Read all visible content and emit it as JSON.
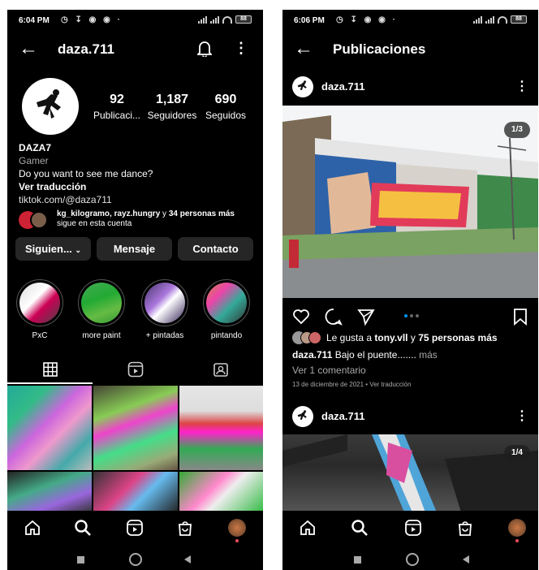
{
  "colors": {
    "background": "#000000",
    "accent": "#0095f6",
    "notify": "#ed4956"
  },
  "left": {
    "status": {
      "time": "6:04 PM",
      "battery": "88"
    },
    "header": {
      "title": "daza.711"
    },
    "stats": [
      {
        "value": "92",
        "label": "Publicaci..."
      },
      {
        "value": "1,187",
        "label": "Seguidores"
      },
      {
        "value": "690",
        "label": "Seguidos"
      }
    ],
    "bio": {
      "name": "DAZA7",
      "category": "Gamer",
      "text": "Do you want to see me dance?",
      "translate": "Ver traducción",
      "link": "tiktok.com/@daza711"
    },
    "followed_by": {
      "names": "kg_kilogramo, rayz.hungry",
      "mid": " y ",
      "others": "34 personas más",
      "suffix": "sigue en esta cuenta"
    },
    "buttons": {
      "following": "Siguien...",
      "message": "Mensaje",
      "contact": "Contacto"
    },
    "highlights": [
      "PxC",
      "more paint",
      "+ pintadas",
      "pintando"
    ],
    "tabs": [
      "grid",
      "reels",
      "tagged"
    ]
  },
  "right": {
    "status": {
      "time": "6:06 PM",
      "battery": "88"
    },
    "header": {
      "title": "Publicaciones"
    },
    "post1": {
      "user": "daza.711",
      "counter": "1/3",
      "likes_prefix": "Le gusta a ",
      "likes_user": "tony.vll",
      "likes_mid": " y ",
      "likes_count": "75 personas más",
      "caption_user": "daza.711",
      "caption_text": " Bajo el puente....... ",
      "caption_more": "más",
      "comments": "Ver 1 comentario",
      "date": "13 de diciembre de 2021 • Ver traducción"
    },
    "post2": {
      "user": "daza.711",
      "counter": "1/4"
    }
  },
  "nav": [
    "home-icon",
    "search-icon",
    "reels-icon",
    "shop-icon",
    "profile-avatar"
  ]
}
